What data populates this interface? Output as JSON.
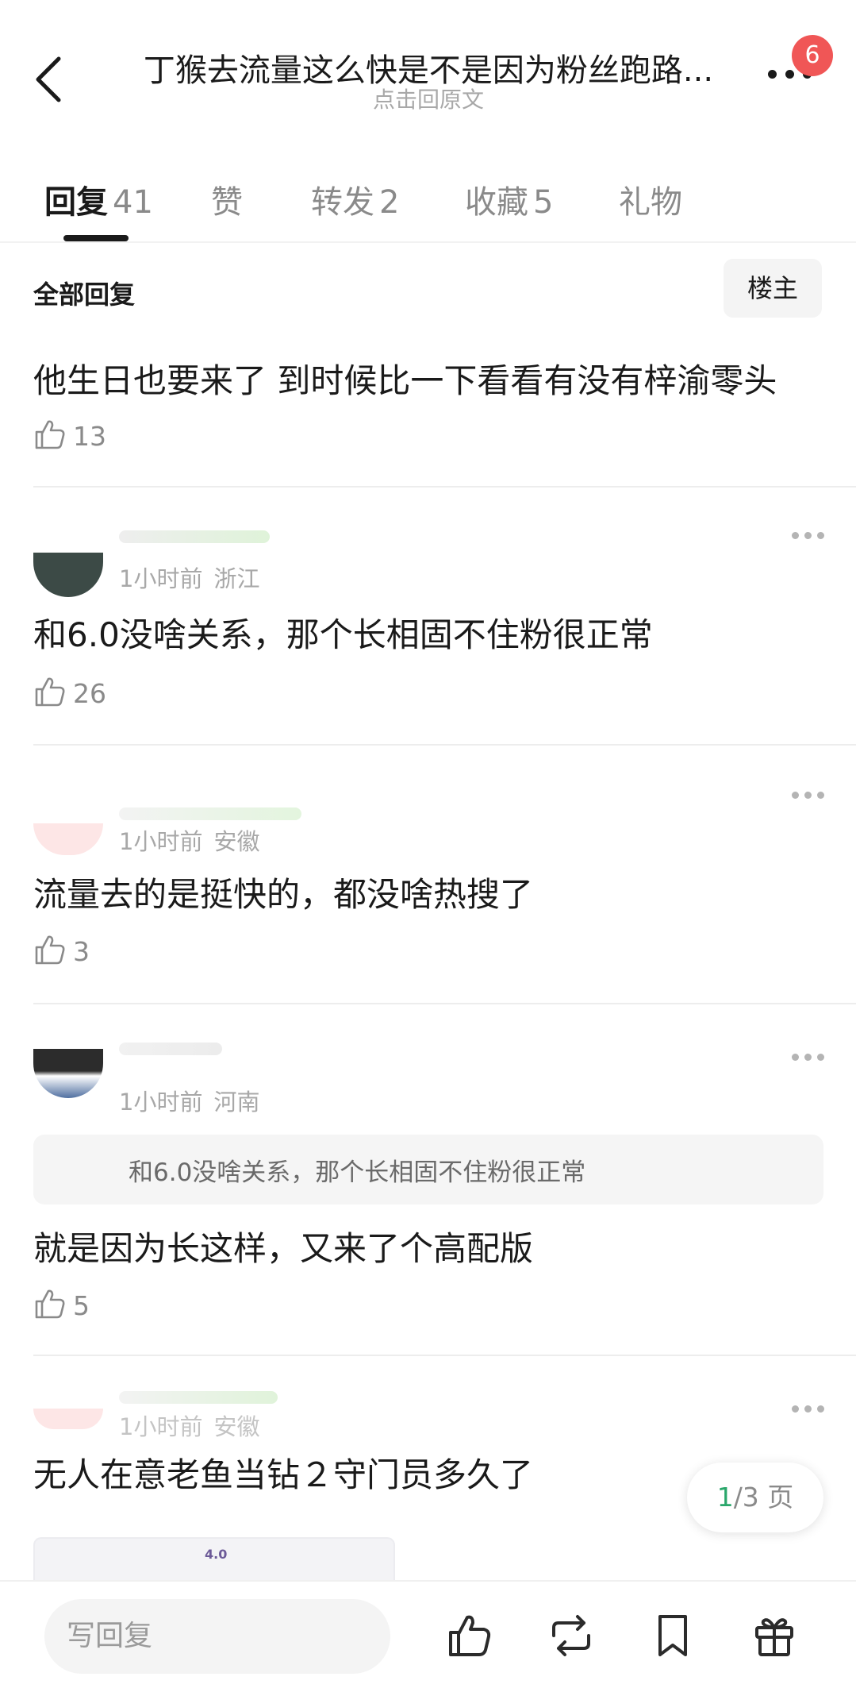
{
  "header": {
    "title": "丁猴去流量这么快是不是因为粉丝跑路...",
    "subtitle": "点击回原文",
    "badge": "6"
  },
  "tabs": [
    {
      "label": "回复",
      "count": "41"
    },
    {
      "label": "赞",
      "count": ""
    },
    {
      "label": "转发",
      "count": "2"
    },
    {
      "label": "收藏",
      "count": "5"
    },
    {
      "label": "礼物",
      "count": ""
    }
  ],
  "filter": {
    "all_replies": "全部回复",
    "op_only": "楼主"
  },
  "top_reply": {
    "text": "他生日也要来了 到时候比一下看看有没有梓渝零头",
    "likes": "13"
  },
  "comments": [
    {
      "time": "1小时前",
      "location": "浙江",
      "text": "和6.0没啥关系，那个长相固不住粉很正常",
      "likes": "26"
    },
    {
      "time": "1小时前",
      "location": "安徽",
      "text": "流量去的是挺快的，都没啥热搜了",
      "likes": "3"
    },
    {
      "time": "1小时前",
      "location": "河南",
      "quote": "和6.0没啥关系，那个长相固不住粉很正常",
      "text": "就是因为长这样，又来了个高配版",
      "likes": "5"
    },
    {
      "time": "1小时前",
      "location": "安徽",
      "text": "无人在意老鱼当钻２守门员多久了",
      "image_label": "4.0"
    }
  ],
  "pager": {
    "current": "1",
    "total": "/3 页"
  },
  "bottom_bar": {
    "reply_placeholder": "写回复"
  },
  "icons": {
    "back": "chevron-left-icon",
    "more": "more-dots-icon",
    "like": "thumbs-up-icon",
    "repost": "repost-icon",
    "favorite": "bookmark-icon",
    "gift": "gift-icon"
  },
  "colors": {
    "badge": "#f05656",
    "pager_current": "#2aa76b",
    "muted_text": "#a8a8a8"
  }
}
